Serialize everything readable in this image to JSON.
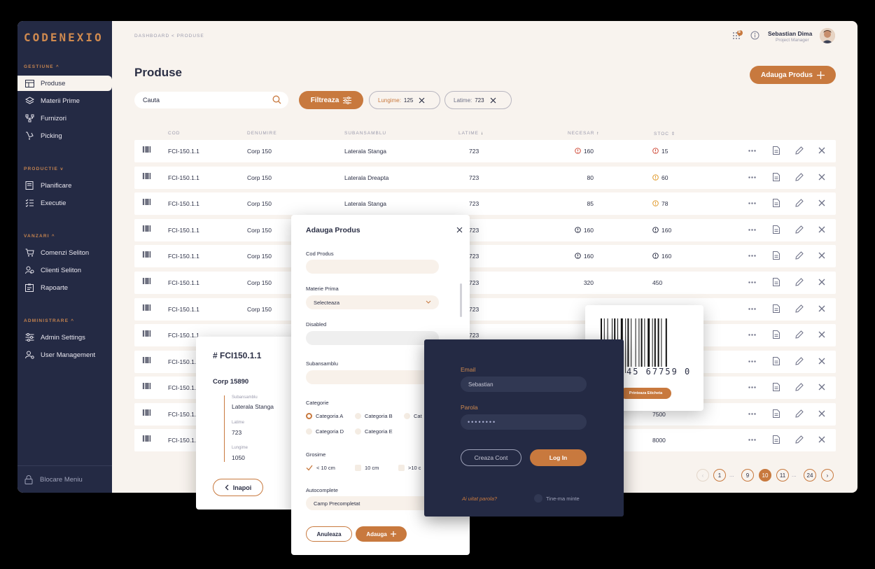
{
  "brand": "CODENEXIO",
  "breadcrumb": "DASHBOARD  <  PRODUSE",
  "header": {
    "notification_count": "8",
    "user_name": "Sebastian Dima",
    "user_role": "Project Manager"
  },
  "sidebar": {
    "sections": [
      {
        "title": "GESTIUNE ^",
        "items": [
          "Produse",
          "Materii Prime",
          "Furnizori",
          "Picking"
        ]
      },
      {
        "title": "PRODUCTIE v",
        "items": [
          "Planificare",
          "Executie"
        ]
      },
      {
        "title": "VANZARI ^",
        "items": [
          "Comenzi Seliton",
          "Clienti Seliton",
          "Rapoarte"
        ]
      },
      {
        "title": "ADMINISTRARE ^",
        "items": [
          "Admin Settings",
          "User Management"
        ]
      }
    ],
    "lock_label": "Blocare Meniu"
  },
  "page": {
    "title": "Produse",
    "add_button": "Adauga Produs",
    "search_value": "Cauta",
    "filter_button": "Filtreaza",
    "chips": [
      {
        "label": "Lungime:",
        "value": "125"
      },
      {
        "label": "Latime:",
        "value": "723"
      }
    ]
  },
  "table": {
    "headers": [
      "COD",
      "DENUMIRE",
      "SUBANSAMBLU",
      "LATIME",
      "NECESAR",
      "STOC"
    ],
    "rows": [
      {
        "cod": "FCI-150.1.1",
        "den": "Corp 150",
        "sub": "Laterala Stanga",
        "lat": "723",
        "nec": "160",
        "nec_warn": "red",
        "stoc": "15",
        "stoc_warn": "red"
      },
      {
        "cod": "FCI-150.1.1",
        "den": "Corp 150",
        "sub": "Laterala Dreapta",
        "lat": "723",
        "nec": "80",
        "nec_warn": "",
        "stoc": "60",
        "stoc_warn": "orange"
      },
      {
        "cod": "FCI-150.1.1",
        "den": "Corp 150",
        "sub": "Laterala Stanga",
        "lat": "723",
        "nec": "85",
        "nec_warn": "",
        "stoc": "78",
        "stoc_warn": "orange"
      },
      {
        "cod": "FCI-150.1.1",
        "den": "Corp 150",
        "sub": "",
        "lat": "723",
        "nec": "160",
        "nec_warn": "dark",
        "stoc": "160",
        "stoc_warn": "dark"
      },
      {
        "cod": "FCI-150.1.1",
        "den": "Corp 150",
        "sub": "",
        "lat": "723",
        "nec": "160",
        "nec_warn": "dark",
        "stoc": "160",
        "stoc_warn": "dark"
      },
      {
        "cod": "FCI-150.1.1",
        "den": "Corp 150",
        "sub": "",
        "lat": "723",
        "nec": "320",
        "nec_warn": "",
        "stoc": "450",
        "stoc_warn": ""
      },
      {
        "cod": "FCI-150.1.1",
        "den": "Corp 150",
        "sub": "",
        "lat": "723",
        "nec": "",
        "nec_warn": "",
        "stoc": "",
        "stoc_warn": ""
      },
      {
        "cod": "FCI-150.1.1",
        "den": "",
        "sub": "",
        "lat": "723",
        "nec": "",
        "nec_warn": "",
        "stoc": "",
        "stoc_warn": ""
      },
      {
        "cod": "FCI-150.1.",
        "den": "",
        "sub": "",
        "lat": "",
        "nec": "",
        "nec_warn": "",
        "stoc": "",
        "stoc_warn": ""
      },
      {
        "cod": "FCI-150.1.",
        "den": "",
        "sub": "",
        "lat": "",
        "nec": "",
        "nec_warn": "",
        "stoc": "",
        "stoc_warn": ""
      },
      {
        "cod": "FCI-150.1.",
        "den": "",
        "sub": "",
        "lat": "",
        "nec": "",
        "nec_warn": "",
        "stoc": "7500",
        "stoc_warn": ""
      },
      {
        "cod": "FCI-150.1.",
        "den": "",
        "sub": "",
        "lat": "",
        "nec": "",
        "nec_warn": "",
        "stoc": "8000",
        "stoc_warn": ""
      }
    ]
  },
  "pagination": [
    "1",
    "...",
    "9",
    "10",
    "11",
    "...",
    "24"
  ],
  "detail_card": {
    "code": "# FCI150.1.1",
    "name": "Corp 15890",
    "sub_label": "Subansamblu",
    "sub_value": "Laterala Stanga",
    "lat_label": "Latime",
    "lat_value": "723",
    "lung_label": "Lungime",
    "lung_value": "1050",
    "back_button": "Inapoi"
  },
  "modal": {
    "title": "Adauga Produs",
    "cod_label": "Cod Produs",
    "materie_label": "Materie Prima",
    "materie_value": "Selecteaza",
    "disabled_label": "Disabled",
    "sub_label": "Subansamblu",
    "cat_label": "Categorie",
    "categories": [
      "Categoria A",
      "Categoria B",
      "Cat",
      "Categoria D",
      "Categoria E"
    ],
    "grosime_label": "Grosime",
    "grosimi": [
      "< 10 cm",
      "10 cm",
      ">10 c"
    ],
    "auto_label": "Autocomplete",
    "auto_value": "Camp Precompletat",
    "cancel": "Anuleaza",
    "submit": "Adauga"
  },
  "barcode": {
    "digits": "45 67759 0",
    "print_button": "Printeaza Eticheta"
  },
  "login": {
    "email_label": "Email",
    "email_value": "Sebastian",
    "password_label": "Parola",
    "password_value": "••••••••",
    "create_button": "Creaza Cont",
    "login_button": "Log In",
    "forgot": "Ai uitat parola?",
    "remember": "Tine-ma minte"
  },
  "colors": {
    "accent": "#c8793e",
    "navy": "#242a44",
    "bg": "#f8f3ee"
  }
}
